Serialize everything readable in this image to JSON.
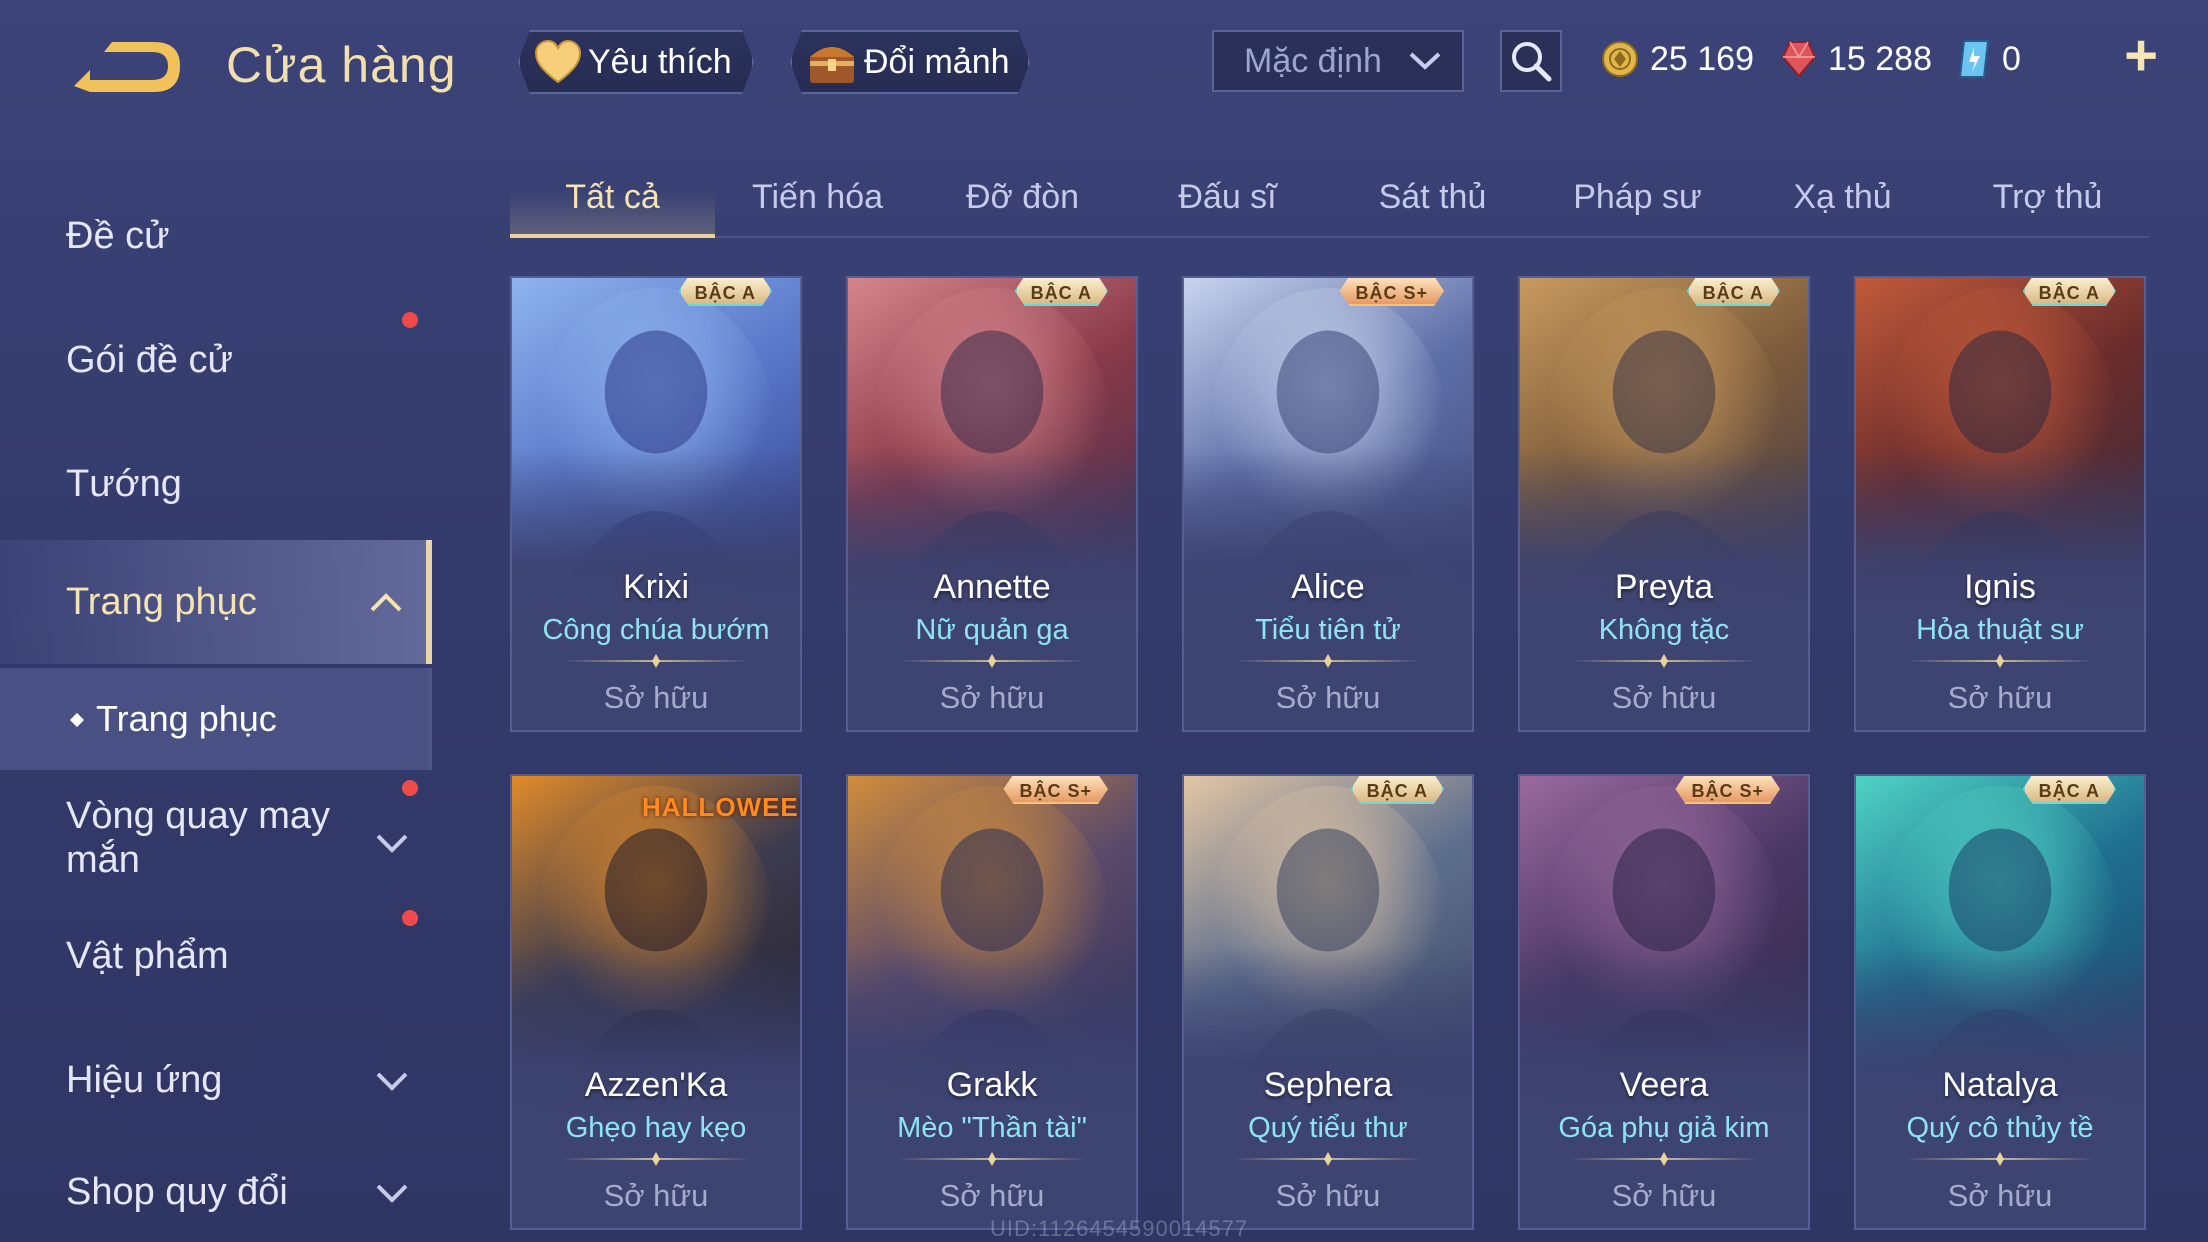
{
  "header": {
    "title": "Cửa hàng",
    "favorite_label": "Yêu thích",
    "exchange_label": "Đổi mảnh",
    "sort_value": "Mặc định",
    "currencies": [
      {
        "icon": "gold-coin-icon",
        "value": "25 169",
        "color": "#e2b64a"
      },
      {
        "icon": "ruby-gem-icon",
        "value": "15 288",
        "color": "#e0555b"
      },
      {
        "icon": "voucher-icon",
        "value": "0",
        "color": "#6cc4f2"
      }
    ]
  },
  "sidebar": {
    "items": [
      {
        "label": "Đề cử",
        "dot": false,
        "chevron": "none"
      },
      {
        "label": "Gói đề cử",
        "dot": true,
        "chevron": "none"
      },
      {
        "label": "Tướng",
        "dot": false,
        "chevron": "none"
      },
      {
        "label": "Trang phục",
        "dot": false,
        "chevron": "up",
        "active": true
      },
      {
        "label": "Vòng quay may mắn",
        "dot": true,
        "chevron": "down"
      },
      {
        "label": "Vật phẩm",
        "dot": true,
        "chevron": "none"
      },
      {
        "label": "Hiệu ứng",
        "dot": false,
        "chevron": "down"
      },
      {
        "label": "Shop quy đổi",
        "dot": false,
        "chevron": "down"
      }
    ],
    "sub_item": "Trang phục"
  },
  "tabs": [
    "Tất cả",
    "Tiến hóa",
    "Đỡ đòn",
    "Đấu sĩ",
    "Sát thủ",
    "Pháp sư",
    "Xạ thủ",
    "Trợ thủ"
  ],
  "active_tab": 0,
  "cards": [
    {
      "hero": "Krixi",
      "skin": "Công chúa bướm",
      "tier": "BẬC A",
      "status": "Sở hữu"
    },
    {
      "hero": "Annette",
      "skin": "Nữ quản ga",
      "tier": "BẬC A",
      "status": "Sở hữu"
    },
    {
      "hero": "Alice",
      "skin": "Tiểu tiên tử",
      "tier": "BẬC S+",
      "status": "Sở hữu"
    },
    {
      "hero": "Preyta",
      "skin": "Không tặc",
      "tier": "BẬC A",
      "status": "Sở hữu"
    },
    {
      "hero": "Ignis",
      "skin": "Hỏa thuật sư",
      "tier": "BẬC A",
      "status": "Sở hữu"
    },
    {
      "hero": "Azzen'Ka",
      "skin": "Ghẹo hay kẹo",
      "tier": "",
      "event": "HALLOWEEN",
      "status": "Sở hữu"
    },
    {
      "hero": "Grakk",
      "skin": "Mèo \"Thần tài\"",
      "tier": "BẬC S+",
      "status": "Sở hữu"
    },
    {
      "hero": "Sephera",
      "skin": "Quý tiểu thư",
      "tier": "BẬC A",
      "status": "Sở hữu"
    },
    {
      "hero": "Veera",
      "skin": "Góa phụ giả kim",
      "tier": "BẬC S+",
      "status": "Sở hữu"
    },
    {
      "hero": "Natalya",
      "skin": "Quý cô thủy tề",
      "tier": "BẬC A",
      "status": "Sở hữu"
    }
  ],
  "watermark": "UID:1126454590014577"
}
